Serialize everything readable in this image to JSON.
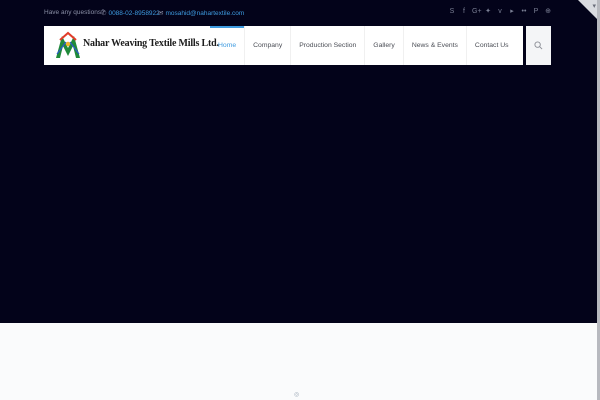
{
  "topbar": {
    "question": "Have any questions?",
    "phone": "0088-02-8958922",
    "email": "mosahid@nahartextile.com"
  },
  "social_icons": [
    "skype-icon",
    "facebook-icon",
    "google-plus-icon",
    "twitter-icon",
    "vimeo-icon",
    "youtube-icon",
    "flickr-icon",
    "pinterest-icon",
    "dribbble-icon"
  ],
  "brand": {
    "name": "Nahar Weaving Textile Mills Ltd."
  },
  "nav": {
    "items": [
      {
        "label": "Home",
        "active": true
      },
      {
        "label": "Company"
      },
      {
        "label": "Production Section"
      },
      {
        "label": "Gallery"
      },
      {
        "label": "News & Events"
      },
      {
        "label": "Contact Us"
      }
    ]
  },
  "colors": {
    "accent": "#3e9be0",
    "hero_bg": "#03031a",
    "header_bg": "#ffffff"
  }
}
